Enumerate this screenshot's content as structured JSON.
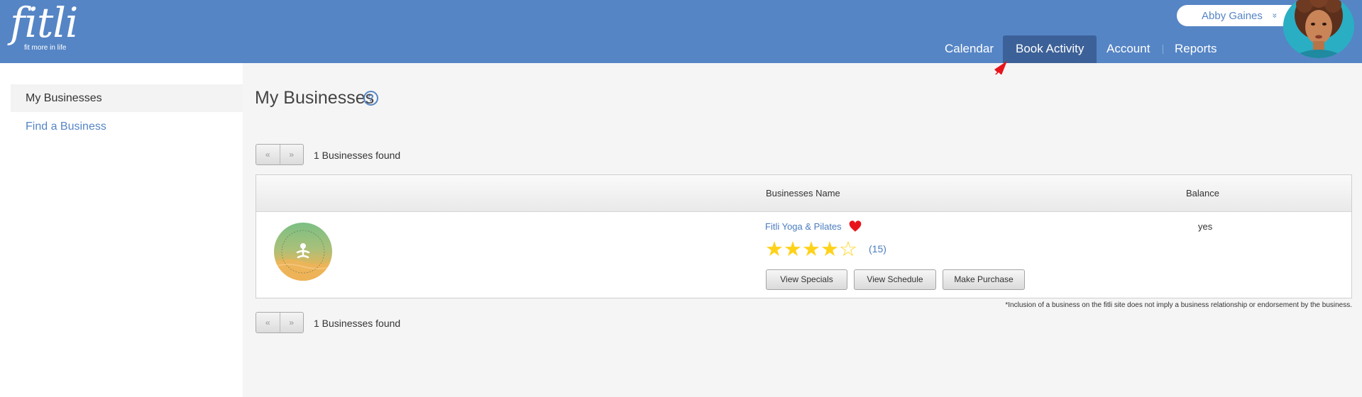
{
  "app": {
    "logo_text": "fitli",
    "logo_tagline": "fit more in life"
  },
  "user": {
    "name": "Abby Gaines",
    "chevron": "»"
  },
  "nav": {
    "items": [
      {
        "label": "Calendar"
      },
      {
        "label": "Book Activity",
        "active": true
      },
      {
        "label": "Account"
      },
      {
        "label": "Reports"
      }
    ]
  },
  "sidebar": {
    "items": [
      {
        "label": "My Businesses",
        "active": true
      },
      {
        "label": "Find a Business"
      }
    ]
  },
  "main": {
    "title": "My Businesses",
    "help_glyph": "?",
    "pager": {
      "prev": "«",
      "next": "»"
    },
    "found_text": "1 Businesses found",
    "table": {
      "headers": {
        "name": "Businesses Name",
        "balance": "Balance"
      },
      "rows": [
        {
          "logo_alt": "Fitli Yoga & Pilates logo",
          "name": "Fitli Yoga & Pilates",
          "favorite": true,
          "rating": 4,
          "rating_max": 5,
          "review_count": "(15)",
          "balance": "yes",
          "actions": [
            "View Specials",
            "View Schedule",
            "Make Purchase"
          ]
        }
      ]
    },
    "disclaimer": "*Inclusion of a business on the fitli site does not imply a business relationship or endorsement by the business."
  },
  "colors": {
    "header": "#5585c5",
    "nav_active": "#3c6198",
    "link": "#4a7cc0",
    "star": "#ffd21a",
    "heart": "#e8141c",
    "annotation_arrow": "#e8141c"
  },
  "icons": {
    "help": "help-circle-icon",
    "favorite": "heart-icon",
    "rating": "star-icon",
    "dropdown": "chevron-down-icon"
  }
}
